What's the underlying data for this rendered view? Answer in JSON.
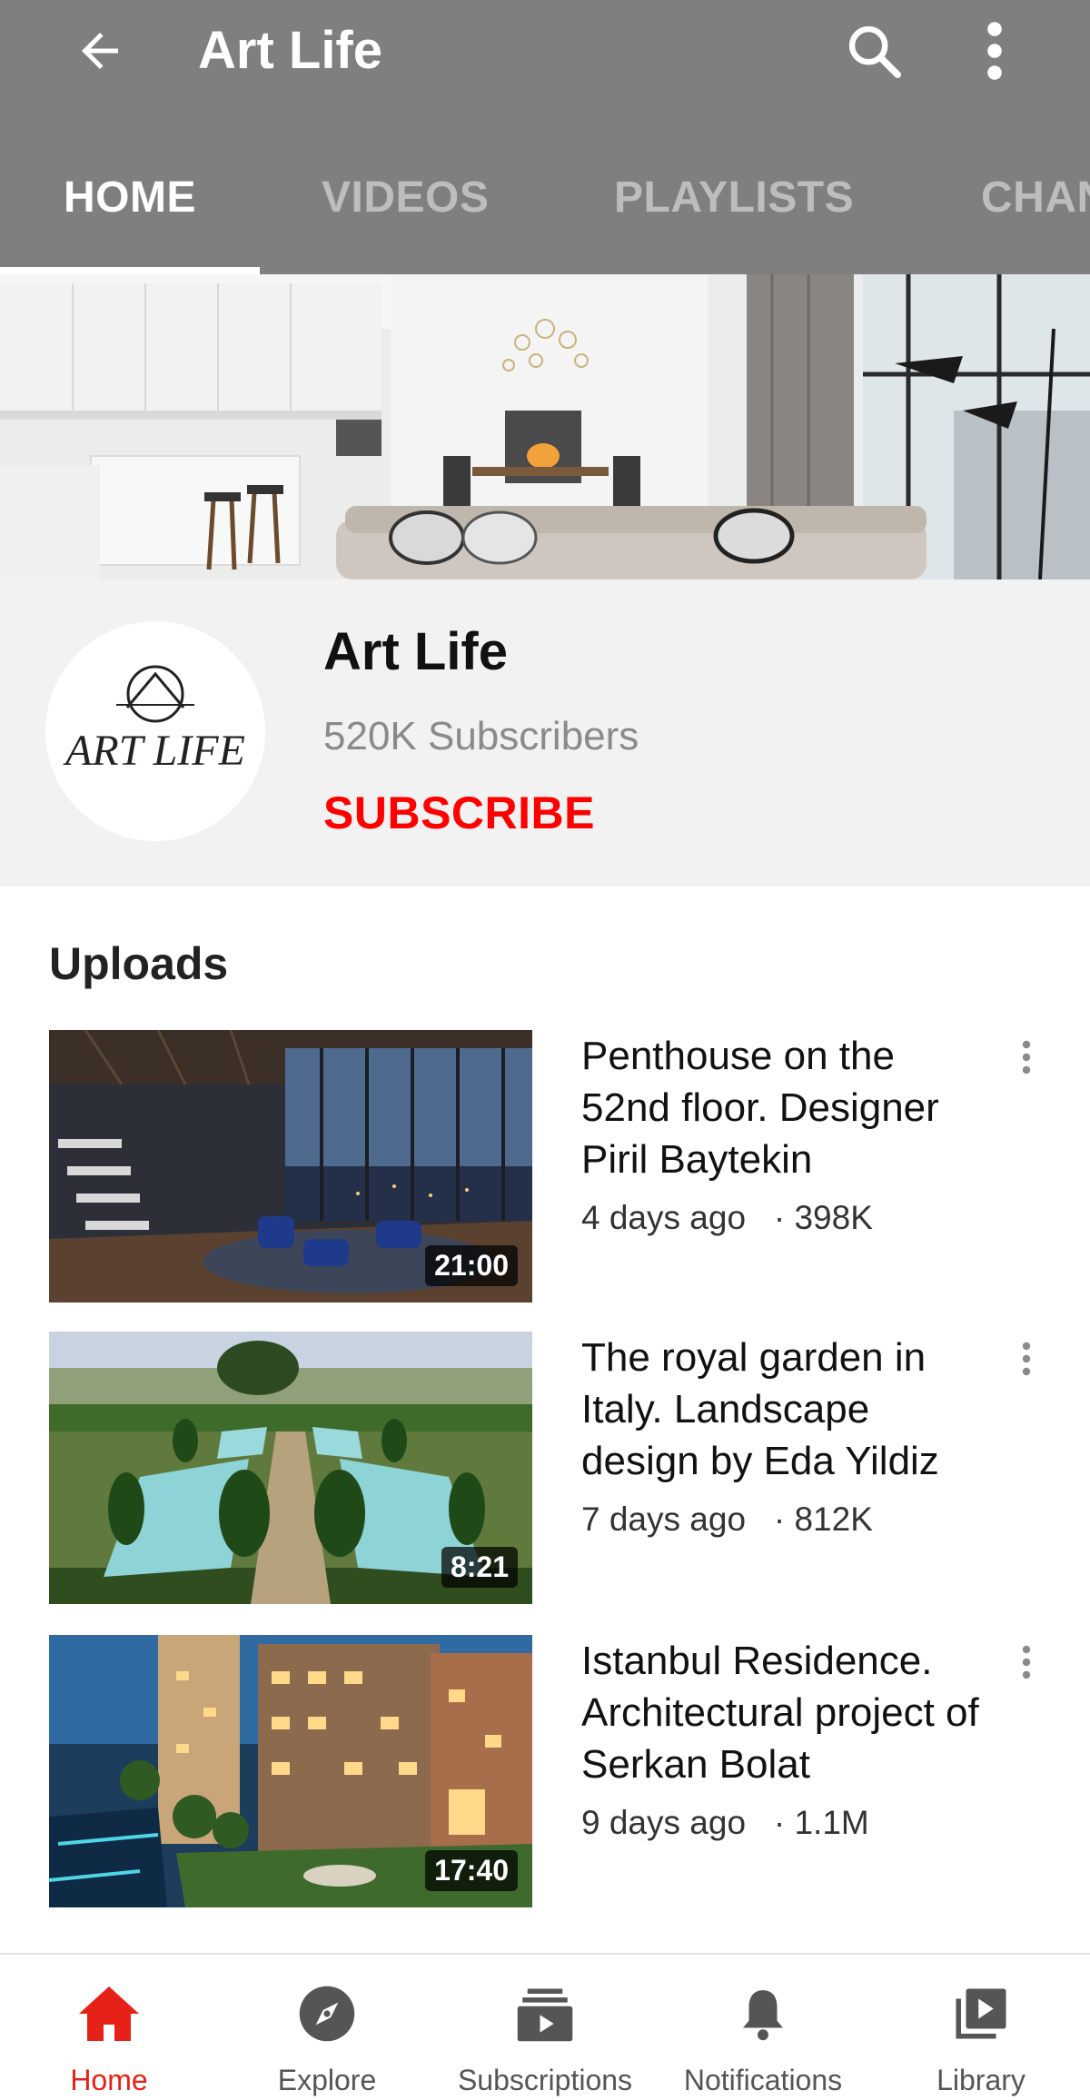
{
  "app_bar": {
    "title": "Art Life",
    "back_icon": "arrow-left-icon",
    "search_icon": "search-icon",
    "more_icon": "more-vertical-icon"
  },
  "tabs": [
    {
      "label": "HOME",
      "active": true
    },
    {
      "label": "VIDEOS",
      "active": false
    },
    {
      "label": "PLAYLISTS",
      "active": false
    },
    {
      "label": "CHANNELS",
      "active": false
    }
  ],
  "channel": {
    "name": "Art Life",
    "subscribers": "520K Subscribers",
    "subscribe_label": "SUBSCRIBE",
    "avatar_logo_text": "ART LIFE"
  },
  "uploads": {
    "title": "Uploads",
    "videos": [
      {
        "title": "Penthouse on the 52nd floor. Designer Piril Baytekin",
        "age": "4 days ago",
        "views": "· 398K",
        "duration": "21:00"
      },
      {
        "title": "The royal garden in Italy. Landscape design by Eda Yildiz",
        "age": "7 days ago",
        "views": "· 812K",
        "duration": "8:21"
      },
      {
        "title": "Istanbul Residence. Architectural project of Serkan Bolat",
        "age": "9 days ago",
        "views": "· 1.1M",
        "duration": "17:40"
      }
    ]
  },
  "bottom_nav": [
    {
      "label": "Home",
      "icon": "home-icon",
      "active": true
    },
    {
      "label": "Explore",
      "icon": "compass-icon",
      "active": false
    },
    {
      "label": "Subscriptions",
      "icon": "subscriptions-icon",
      "active": false
    },
    {
      "label": "Notifications",
      "icon": "bell-icon",
      "active": false
    },
    {
      "label": "Library",
      "icon": "library-icon",
      "active": false
    }
  ],
  "colors": {
    "app_bar": "#7f7f7f",
    "accent_red": "#ff0000",
    "nav_active": "#e62117"
  }
}
